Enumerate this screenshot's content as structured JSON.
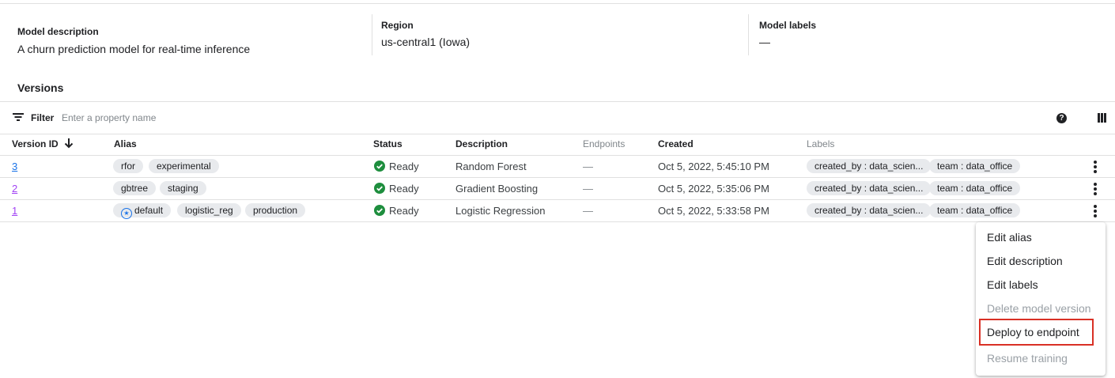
{
  "meta": {
    "model_description_label": "Model description",
    "model_description_value": "A churn prediction model for real-time inference",
    "region_label": "Region",
    "region_value": "us-central1 (Iowa)",
    "model_labels_label": "Model labels",
    "model_labels_value": "—"
  },
  "versions_heading": "Versions",
  "filter": {
    "label": "Filter",
    "placeholder": "Enter a property name"
  },
  "columns": [
    "Version ID",
    "Alias",
    "Status",
    "Description",
    "Endpoints",
    "Created",
    "Labels"
  ],
  "rows": [
    {
      "version_id": "3",
      "aliases": [
        "rfor",
        "experimental"
      ],
      "status": "Ready",
      "description": "Random Forest",
      "endpoints": "—",
      "created": "Oct 5, 2022, 5:45:10 PM",
      "labels": [
        "created_by : data_scien...",
        "team : data_office"
      ]
    },
    {
      "version_id": "2",
      "aliases": [
        "gbtree",
        "staging"
      ],
      "status": "Ready",
      "description": "Gradient Boosting",
      "endpoints": "—",
      "created": "Oct 5, 2022, 5:35:06 PM",
      "labels": [
        "created_by : data_scien...",
        "team : data_office"
      ]
    },
    {
      "version_id": "1",
      "aliases": [
        "default",
        "logistic_reg",
        "production"
      ],
      "status": "Ready",
      "description": "Logistic Regression",
      "endpoints": "—",
      "created": "Oct 5, 2022, 5:33:58 PM",
      "labels": [
        "created_by : data_scien...",
        "team : data_office"
      ]
    }
  ],
  "context_menu": {
    "items": [
      {
        "label": "Edit alias",
        "enabled": true
      },
      {
        "label": "Edit description",
        "enabled": true
      },
      {
        "label": "Edit labels",
        "enabled": true
      },
      {
        "label": "Delete model version",
        "enabled": false
      },
      {
        "label": "Deploy to endpoint",
        "enabled": true,
        "highlighted": true
      },
      {
        "label": "Resume training",
        "enabled": false
      }
    ]
  },
  "colors": {
    "link": "#1a73e8",
    "visited_link": "#a142f4",
    "ready": "#1e8e3e",
    "highlight": "#d93025",
    "chip_bg": "#e8eaed"
  },
  "icons": {
    "filter": "filter-lines-icon",
    "help": "help-circle-icon",
    "columns": "column-display-icon",
    "sort": "arrow-down-icon",
    "status": "check-circle-icon",
    "default_alias": "star-circle-icon",
    "more": "more-vert-icon"
  }
}
